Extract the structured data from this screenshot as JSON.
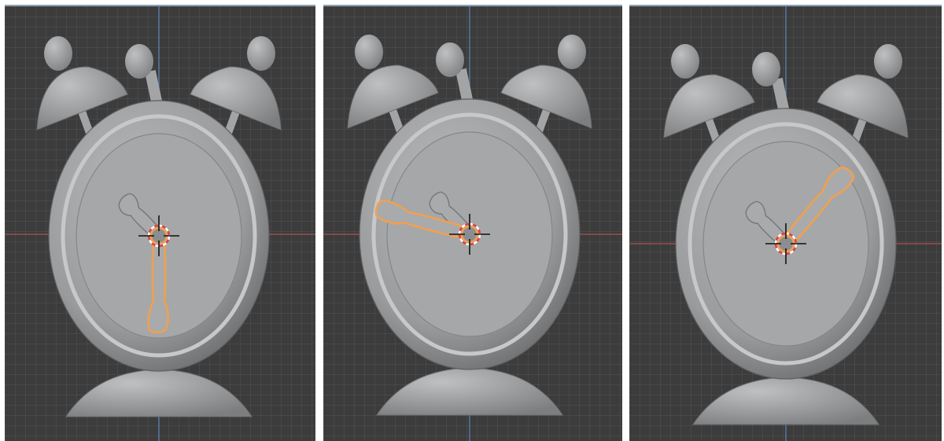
{
  "viewports": [
    {
      "hand_angle_deg": 180,
      "hand_state": "selected"
    },
    {
      "hand_angle_deg": -75,
      "hand_state": "selected"
    },
    {
      "hand_angle_deg": 40,
      "hand_state": "selected"
    }
  ],
  "colors": {
    "viewport_bg": "#3c3c3c",
    "grid_line": "#4a4a4a",
    "x_axis": "#b0504f",
    "y_axis": "#5b7fae",
    "clock_body": "#9c9d9f",
    "clock_face": "#a6a7a9",
    "selection_outline": "#f0a050",
    "cursor_ring_red": "#e04040",
    "cursor_ring_white": "#ffffff"
  },
  "icons": {
    "cursor": "3d-cursor-icon",
    "object": "alarm-clock-model-icon"
  }
}
